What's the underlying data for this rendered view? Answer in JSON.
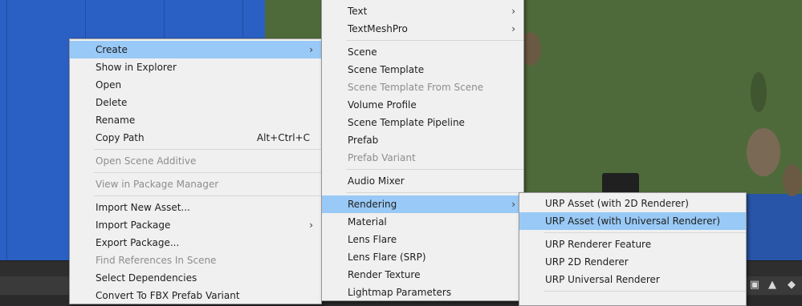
{
  "context_menu": {
    "items": [
      {
        "label": "Create",
        "has_submenu": true
      },
      {
        "label": "Show in Explorer"
      },
      {
        "label": "Open"
      },
      {
        "label": "Delete"
      },
      {
        "label": "Rename"
      },
      {
        "label": "Copy Path",
        "shortcut": "Alt+Ctrl+C"
      },
      {
        "label": "Open Scene Additive"
      },
      {
        "label": "View in Package Manager"
      },
      {
        "label": "Import New Asset..."
      },
      {
        "label": "Import Package",
        "has_submenu": true
      },
      {
        "label": "Export Package..."
      },
      {
        "label": "Find References In Scene"
      },
      {
        "label": "Select Dependencies"
      },
      {
        "label": "Convert To FBX Prefab Variant"
      }
    ]
  },
  "create_submenu": {
    "items": [
      {
        "label": "Text"
      },
      {
        "label": "TextMeshPro"
      },
      {
        "label": "Scene"
      },
      {
        "label": "Scene Template"
      },
      {
        "label": "Scene Template From Scene"
      },
      {
        "label": "Volume Profile"
      },
      {
        "label": "Scene Template Pipeline"
      },
      {
        "label": "Prefab"
      },
      {
        "label": "Prefab Variant"
      },
      {
        "label": "Audio Mixer"
      },
      {
        "label": "Rendering"
      },
      {
        "label": "Material"
      },
      {
        "label": "Lens Flare"
      },
      {
        "label": "Lens Flare (SRP)"
      },
      {
        "label": "Render Texture"
      },
      {
        "label": "Lightmap Parameters"
      }
    ],
    "arrow_glyph": "›"
  },
  "rendering_submenu": {
    "items": [
      {
        "label": "URP Asset (with 2D Renderer)"
      },
      {
        "label": "URP Asset (with Universal Renderer)"
      },
      {
        "label": "URP Renderer Feature"
      },
      {
        "label": "URP 2D Renderer"
      },
      {
        "label": "URP Universal Renderer"
      }
    ]
  },
  "colors": {
    "highlight": "#99c9f6",
    "menu_bg": "#f0f0f0",
    "disabled_text": "#8d8d8d",
    "scene_blue": "#2a5fc4",
    "scene_green": "#4f6a3a"
  }
}
